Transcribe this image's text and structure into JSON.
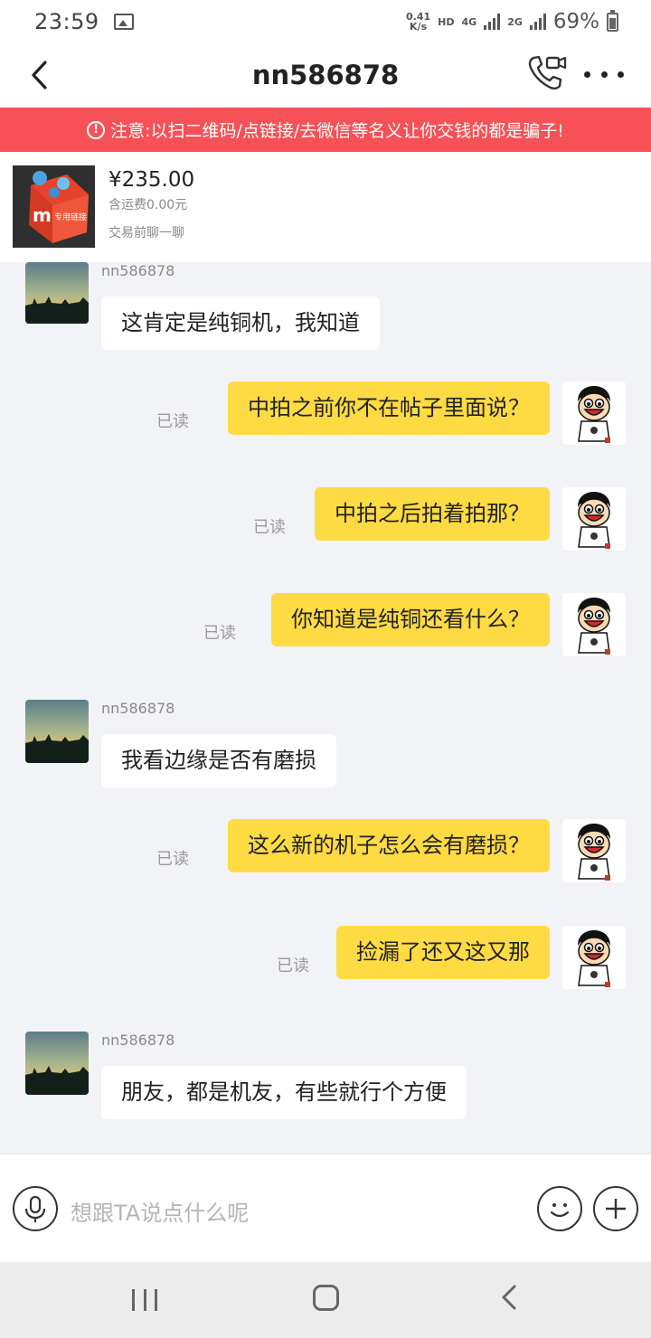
{
  "status_bar": {
    "time": "23:59",
    "net_speed_value": "0.41",
    "net_speed_unit": "K/s",
    "hd": "HD",
    "network_1": "4G",
    "network_2": "2G",
    "battery": "69%"
  },
  "header": {
    "title": "nn586878"
  },
  "warning": {
    "text": "注意:以扫二维码/点链接/去微信等名义让你交钱的都是骗子!"
  },
  "product": {
    "price": "¥235.00",
    "shipping": "含运费0.00元",
    "chat_prompt": "交易前聊一聊",
    "thumb_label": "专用链接"
  },
  "messages": [
    {
      "side": "in",
      "sender": "nn586878",
      "text": "这肯定是纯铜机，我知道"
    },
    {
      "side": "out",
      "status": "已读",
      "text": "中拍之前你不在帖子里面说？"
    },
    {
      "side": "out",
      "status": "已读",
      "text": "中拍之后拍着拍那？"
    },
    {
      "side": "out",
      "status": "已读",
      "text": "你知道是纯铜还看什么？"
    },
    {
      "side": "in",
      "sender": "nn586878",
      "text": "我看边缘是否有磨损"
    },
    {
      "side": "out",
      "status": "已读",
      "text": "这么新的机子怎么会有磨损？"
    },
    {
      "side": "out",
      "status": "已读",
      "text": "捡漏了还又这又那"
    },
    {
      "side": "in",
      "sender": "nn586878",
      "text": "朋友，都是机友，有些就行个方便"
    }
  ],
  "input": {
    "placeholder": "想跟TA说点什么呢"
  },
  "colors": {
    "warning_bg": "#f55156",
    "outgoing_bubble": "#fedb43",
    "incoming_bubble": "#ffffff",
    "chat_bg": "#f2f3f7"
  },
  "icons": {
    "back": "chevron-left-icon",
    "video_call": "video-call-icon",
    "more": "more-dots-icon",
    "mic": "microphone-icon",
    "emoji": "emoji-smile-icon",
    "plus": "plus-icon"
  }
}
